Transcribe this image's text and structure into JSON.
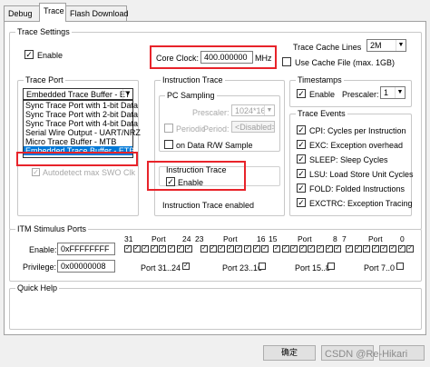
{
  "tabs": [
    {
      "label": "Debug"
    },
    {
      "label": "Trace"
    },
    {
      "label": "Flash Download"
    }
  ],
  "trace_settings": {
    "group_title": "Trace Settings",
    "enable_label": "Enable",
    "enable_checked": "✓",
    "core_clock_label": "Core Clock:",
    "core_clock_value": "400.000000",
    "core_clock_unit": "MHz",
    "cache_lines_label": "Trace Cache Lines",
    "cache_lines_value": "2M",
    "use_cache_file_label": "Use Cache File (max. 1GB)"
  },
  "trace_port": {
    "group_title": "Trace Port",
    "selected": "Embedded Trace Buffer - ET",
    "options": [
      "Sync Trace Port with 1-bit Data",
      "Sync Trace Port with 2-bit Data",
      "Sync Trace Port with 4-bit Data",
      "Serial Wire Output - UART/NRZ",
      "Micro Trace Buffer - MTB",
      "Embedded Trace Buffer - ETB"
    ],
    "autodetect_label": "Autodetect max SWO Clk"
  },
  "instruction_trace": {
    "group_title": "Instruction Trace",
    "pc_sampling_title": "PC Sampling",
    "prescaler_label": "Prescaler:",
    "prescaler_value": "1024*16",
    "periodic_label": "Periodic",
    "period_label": "Period:",
    "period_value": "<Disabled>",
    "on_data_rw_label": "on Data R/W Sample",
    "inner_title": "Instruction Trace",
    "inner_enable_label": "Enable",
    "inner_enable_checked": "✓",
    "status_text": "Instruction Trace enabled"
  },
  "timestamps": {
    "group_title": "Timestamps",
    "enable_label": "Enable",
    "enable_checked": "✓",
    "prescaler_label": "Prescaler:",
    "prescaler_value": "1"
  },
  "trace_events": {
    "group_title": "Trace Events",
    "items": [
      {
        "label": "CPI: Cycles per Instruction",
        "checked": "✓"
      },
      {
        "label": "EXC: Exception overhead",
        "checked": "✓"
      },
      {
        "label": "SLEEP: Sleep Cycles",
        "checked": "✓"
      },
      {
        "label": "LSU: Load Store Unit Cycles",
        "checked": "✓"
      },
      {
        "label": "FOLD: Folded Instructions",
        "checked": "✓"
      },
      {
        "label": "EXCTRC: Exception Tracing",
        "checked": "✓"
      }
    ]
  },
  "itm": {
    "group_title": "ITM Stimulus Ports",
    "enable_label": "Enable:",
    "enable_value": "0xFFFFFFFF",
    "privilege_label": "Privilege:",
    "privilege_value": "0x00000008",
    "bit_labels": [
      "31",
      "Port",
      "24",
      "23",
      "Port",
      "16",
      "15",
      "Port",
      "8",
      "7",
      "Port",
      "0"
    ],
    "priv_labels": [
      "Port 31..24",
      "Port 23..16",
      "Port 15..8",
      "Port 7..0"
    ],
    "check_mark": "✓"
  },
  "quick_help": {
    "group_title": "Quick Help"
  },
  "footer": {
    "ok_label": "确定",
    "watermark": "CSDN @Re-Hikari"
  }
}
